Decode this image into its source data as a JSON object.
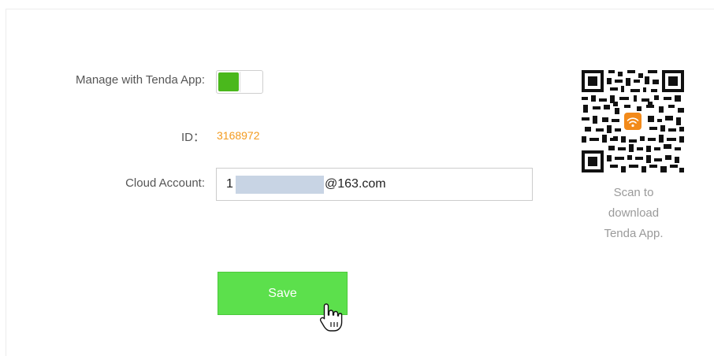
{
  "form": {
    "manage_label": "Manage with Tenda App:",
    "manage_enabled": true,
    "id_label": "ID：",
    "id_value": "3168972",
    "cloud_label": "Cloud Account:",
    "cloud_prefix": "1",
    "cloud_suffix": "@163.com",
    "save_label": "Save"
  },
  "qr": {
    "caption_line1": "Scan to",
    "caption_line2": "download",
    "caption_line3": "Tenda App."
  },
  "colors": {
    "toggle_on": "#4ab81c",
    "id_value": "#f39a1e",
    "save_button": "#5ce04c",
    "caption": "#9a9a9a"
  },
  "icons": {
    "cursor": "hand-pointer-icon",
    "qr": "qr-code-icon",
    "wifi_logo": "wifi-icon"
  }
}
